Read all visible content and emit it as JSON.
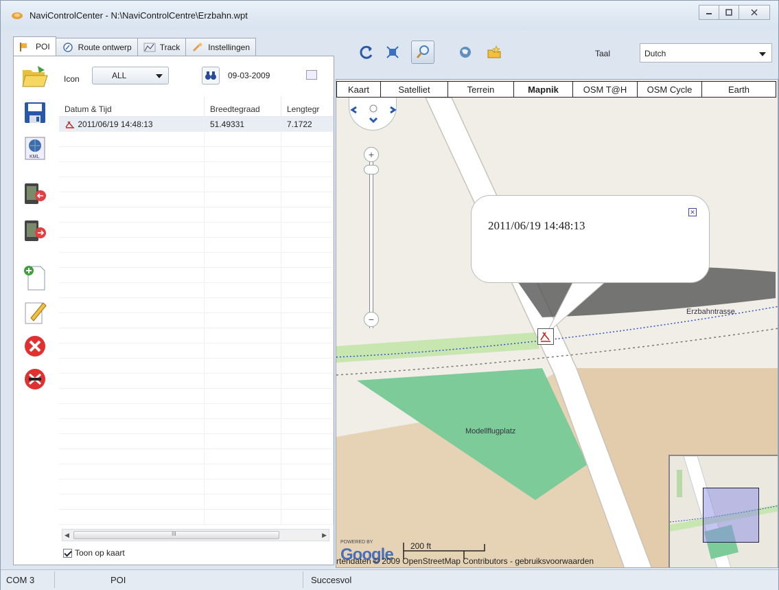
{
  "window": {
    "title": "NaviControlCenter - N:\\NaviControlCentre\\Erzbahn.wpt",
    "controls": [
      "minimize",
      "maximize",
      "close"
    ]
  },
  "tabs": [
    {
      "label": "POI",
      "icon": "poi-flag-icon",
      "active": true
    },
    {
      "label": "Route ontwerp",
      "icon": "route-icon",
      "active": false
    },
    {
      "label": "Track",
      "icon": "track-icon",
      "active": false
    },
    {
      "label": "Instellingen",
      "icon": "settings-icon",
      "active": false
    }
  ],
  "toolstrip": [
    "open-folder-icon",
    "save-icon",
    "kml-icon",
    "device-download-icon",
    "device-upload-icon",
    "new-document-icon",
    "edit-pencil-icon",
    "delete-red-icon",
    "delete-all-icon"
  ],
  "filter": {
    "icon_label": "Icon",
    "icon_value": "ALL",
    "date_value": "09-03-2009"
  },
  "grid": {
    "headers": [
      "Datum & Tijd",
      "Breedtegraad",
      "Lengtegr"
    ],
    "rows": [
      {
        "datetime": "2011/06/19 14:48:13",
        "lat": "51.49331",
        "lon": "7.1722"
      }
    ]
  },
  "scrollbar_glyph": "III",
  "show_on_map": {
    "label": "Toon op kaart",
    "checked": true
  },
  "map_toolbar": {
    "icons": [
      "refresh-icon",
      "fit-icon",
      "zoom-search-icon",
      "globe-icon",
      "folder-star-icon"
    ],
    "taal_label": "Taal",
    "taal_value": "Dutch"
  },
  "map_types": [
    {
      "label": "Kaart",
      "selected": false
    },
    {
      "label": "Satelliet",
      "selected": false
    },
    {
      "label": "Terrein",
      "selected": false
    },
    {
      "label": "Mapnik",
      "selected": true
    },
    {
      "label": "OSM T@H",
      "selected": false
    },
    {
      "label": "OSM Cycle",
      "selected": false
    },
    {
      "label": "Earth",
      "selected": false
    }
  ],
  "map": {
    "popup_text": "2011/06/19 14:48:13",
    "street_label": "Erzbahntrasse",
    "area_label": "Modellflugplatz",
    "scale_label": "200 ft",
    "powered_by": "POWERED BY",
    "google": "Google",
    "attribution": "rtendaten © 2009 OpenStreetMap Contributors - gebruiksvoorwaarden",
    "zoom_in": "+",
    "zoom_out": "−"
  },
  "status": {
    "port": "COM 3",
    "mode": "POI",
    "message": "Succesvol"
  }
}
